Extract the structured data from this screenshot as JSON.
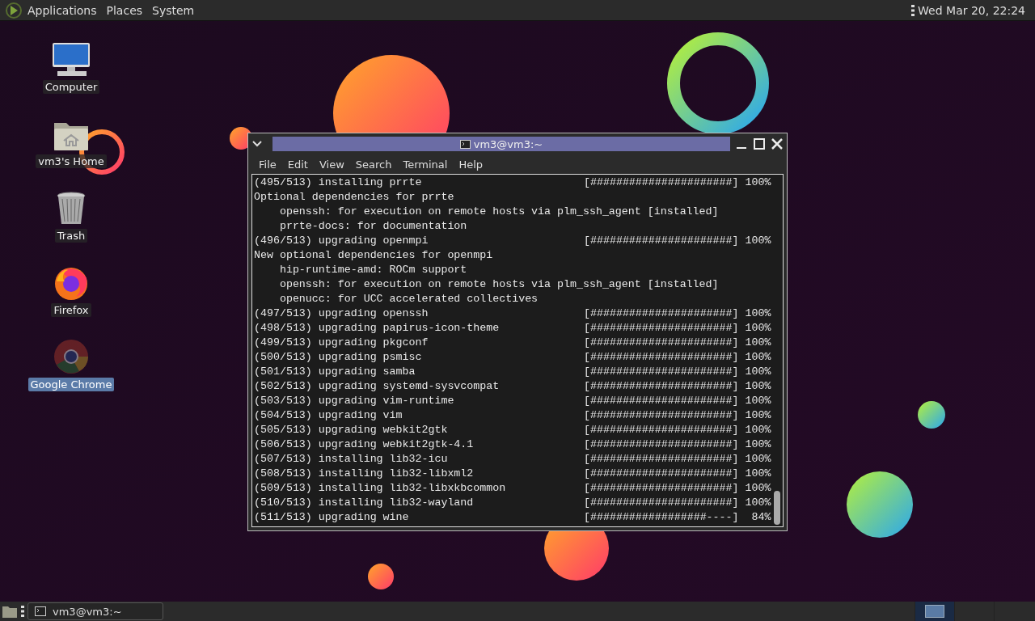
{
  "top_panel": {
    "menus": [
      {
        "label": "Applications"
      },
      {
        "label": "Places"
      },
      {
        "label": "System"
      }
    ],
    "clock": "Wed Mar 20, 22:24"
  },
  "desktop_icons": [
    {
      "label": "Computer",
      "kind": "computer",
      "selected": false
    },
    {
      "label": "vm3's Home",
      "kind": "home",
      "selected": false
    },
    {
      "label": "Trash",
      "kind": "trash",
      "selected": false
    },
    {
      "label": "Firefox",
      "kind": "firefox",
      "selected": false
    },
    {
      "label": "Google Chrome",
      "kind": "chrome",
      "selected": true
    }
  ],
  "terminal": {
    "title": "vm3@vm3:~",
    "menu": [
      {
        "label": "File"
      },
      {
        "label": "Edit"
      },
      {
        "label": "View"
      },
      {
        "label": "Search"
      },
      {
        "label": "Terminal"
      },
      {
        "label": "Help"
      }
    ],
    "lines": [
      {
        "kind": "progress",
        "text": "(495/513) installing prrte",
        "bar": "[######################]",
        "percent": "100%"
      },
      {
        "kind": "text",
        "text": "Optional dependencies for prrte"
      },
      {
        "kind": "text",
        "text": "    openssh: for execution on remote hosts via plm_ssh_agent [installed]"
      },
      {
        "kind": "text",
        "text": "    prrte-docs: for documentation"
      },
      {
        "kind": "progress",
        "text": "(496/513) upgrading openmpi",
        "bar": "[######################]",
        "percent": "100%"
      },
      {
        "kind": "text",
        "text": "New optional dependencies for openmpi"
      },
      {
        "kind": "text",
        "text": "    hip-runtime-amd: ROCm support"
      },
      {
        "kind": "text",
        "text": "    openssh: for execution on remote hosts via plm_ssh_agent [installed]"
      },
      {
        "kind": "text",
        "text": "    openucc: for UCC accelerated collectives"
      },
      {
        "kind": "progress",
        "text": "(497/513) upgrading openssh",
        "bar": "[######################]",
        "percent": "100%"
      },
      {
        "kind": "progress",
        "text": "(498/513) upgrading papirus-icon-theme",
        "bar": "[######################]",
        "percent": "100%"
      },
      {
        "kind": "progress",
        "text": "(499/513) upgrading pkgconf",
        "bar": "[######################]",
        "percent": "100%"
      },
      {
        "kind": "progress",
        "text": "(500/513) upgrading psmisc",
        "bar": "[######################]",
        "percent": "100%"
      },
      {
        "kind": "progress",
        "text": "(501/513) upgrading samba",
        "bar": "[######################]",
        "percent": "100%"
      },
      {
        "kind": "progress",
        "text": "(502/513) upgrading systemd-sysvcompat",
        "bar": "[######################]",
        "percent": "100%"
      },
      {
        "kind": "progress",
        "text": "(503/513) upgrading vim-runtime",
        "bar": "[######################]",
        "percent": "100%"
      },
      {
        "kind": "progress",
        "text": "(504/513) upgrading vim",
        "bar": "[######################]",
        "percent": "100%"
      },
      {
        "kind": "progress",
        "text": "(505/513) upgrading webkit2gtk",
        "bar": "[######################]",
        "percent": "100%"
      },
      {
        "kind": "progress",
        "text": "(506/513) upgrading webkit2gtk-4.1",
        "bar": "[######################]",
        "percent": "100%"
      },
      {
        "kind": "progress",
        "text": "(507/513) installing lib32-icu",
        "bar": "[######################]",
        "percent": "100%"
      },
      {
        "kind": "progress",
        "text": "(508/513) installing lib32-libxml2",
        "bar": "[######################]",
        "percent": "100%"
      },
      {
        "kind": "progress",
        "text": "(509/513) installing lib32-libxkbcommon",
        "bar": "[######################]",
        "percent": "100%"
      },
      {
        "kind": "progress",
        "text": "(510/513) installing lib32-wayland",
        "bar": "[######################]",
        "percent": "100%"
      },
      {
        "kind": "progress",
        "text": "(511/513) upgrading wine",
        "bar": "[##################----]",
        "percent": "84%"
      }
    ]
  },
  "taskbar": {
    "windows": [
      {
        "label": "vm3@vm3:~"
      }
    ]
  }
}
